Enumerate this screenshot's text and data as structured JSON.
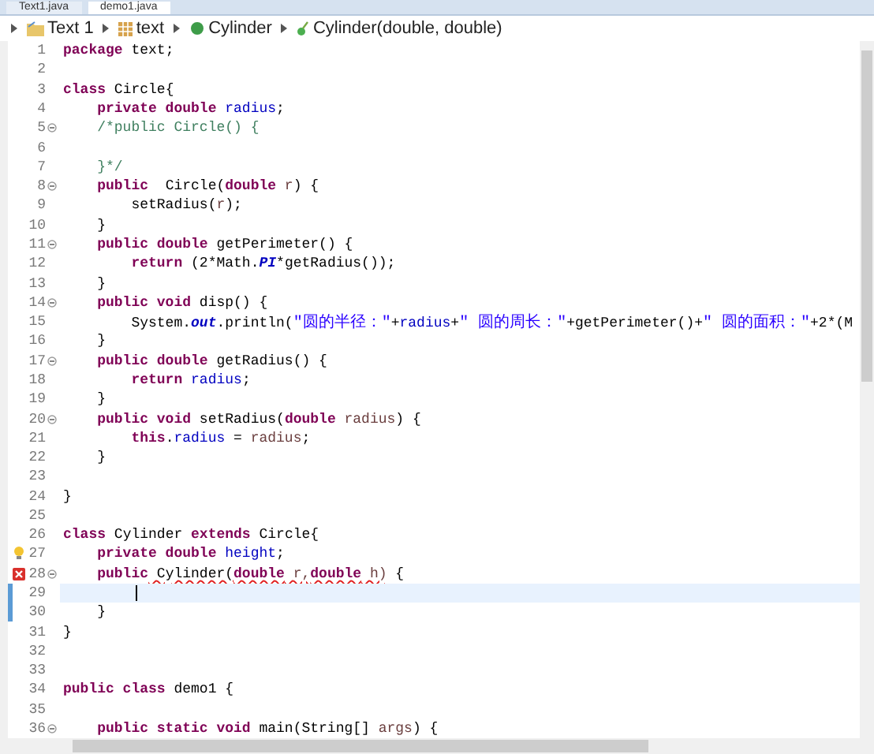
{
  "tabs": [
    {
      "label": "Text1.java",
      "selected": false
    },
    {
      "label": "demo1.java",
      "selected": true
    }
  ],
  "breadcrumb": [
    {
      "kind": "project",
      "label": "Text 1"
    },
    {
      "kind": "package",
      "label": "text"
    },
    {
      "kind": "class",
      "label": "Cylinder"
    },
    {
      "kind": "method",
      "label": "Cylinder(double, double)"
    }
  ],
  "lines": [
    {
      "number": "1",
      "tokens": [
        {
          "kind": "kw",
          "text": "package"
        },
        {
          "kind": "plain",
          "text": " text;"
        }
      ]
    },
    {
      "number": "2"
    },
    {
      "number": "3",
      "tokens": [
        {
          "kind": "kw",
          "text": "class"
        },
        {
          "kind": "plain",
          "text": " Circle{"
        }
      ]
    },
    {
      "number": "4",
      "tokens": [
        {
          "kind": "kw",
          "text": "    private double"
        },
        {
          "kind": "field",
          "text": " radius"
        },
        {
          "kind": "plain",
          "text": ";"
        }
      ]
    },
    {
      "number": "5",
      "fold": true,
      "tokens": [
        {
          "kind": "comment",
          "text": "    /*public Circle() {"
        }
      ]
    },
    {
      "number": "6"
    },
    {
      "number": "7",
      "tokens": [
        {
          "kind": "comment",
          "text": "    }*/"
        }
      ]
    },
    {
      "number": "8",
      "fold": true,
      "tokens": [
        {
          "kind": "kw",
          "text": "    public"
        },
        {
          "kind": "plain",
          "text": "  Circle("
        },
        {
          "kind": "kw",
          "text": "double"
        },
        {
          "kind": "param",
          "text": " r"
        },
        {
          "kind": "plain",
          "text": ") {"
        }
      ]
    },
    {
      "number": "9",
      "tokens": [
        {
          "kind": "plain",
          "text": "        setRadius("
        },
        {
          "kind": "param",
          "text": "r"
        },
        {
          "kind": "plain",
          "text": ");"
        }
      ]
    },
    {
      "number": "10",
      "tokens": [
        {
          "kind": "plain",
          "text": "    }"
        }
      ]
    },
    {
      "number": "11",
      "fold": true,
      "tokens": [
        {
          "kind": "kw",
          "text": "    public double"
        },
        {
          "kind": "plain",
          "text": " getPerimeter() {"
        }
      ]
    },
    {
      "number": "12",
      "tokens": [
        {
          "kind": "kw",
          "text": "        return"
        },
        {
          "kind": "plain",
          "text": " (2*Math."
        },
        {
          "kind": "static",
          "text": "PI"
        },
        {
          "kind": "plain",
          "text": "*getRadius());"
        }
      ]
    },
    {
      "number": "13",
      "tokens": [
        {
          "kind": "plain",
          "text": "    }"
        }
      ]
    },
    {
      "number": "14",
      "fold": true,
      "tokens": [
        {
          "kind": "kw",
          "text": "    public void"
        },
        {
          "kind": "plain",
          "text": " disp() {"
        }
      ]
    },
    {
      "number": "15",
      "tokens": [
        {
          "kind": "plain",
          "text": "        System."
        },
        {
          "kind": "static",
          "text": "out"
        },
        {
          "kind": "plain",
          "text": ".println("
        },
        {
          "kind": "str",
          "text": "\"圆的半径：\""
        },
        {
          "kind": "plain",
          "text": "+"
        },
        {
          "kind": "field",
          "text": "radius"
        },
        {
          "kind": "plain",
          "text": "+"
        },
        {
          "kind": "str",
          "text": "\" 圆的周长：\""
        },
        {
          "kind": "plain",
          "text": "+getPerimeter()+"
        },
        {
          "kind": "str",
          "text": "\" 圆的面积：\""
        },
        {
          "kind": "plain",
          "text": "+2*(M"
        }
      ]
    },
    {
      "number": "16",
      "tokens": [
        {
          "kind": "plain",
          "text": "    }"
        }
      ]
    },
    {
      "number": "17",
      "fold": true,
      "tokens": [
        {
          "kind": "kw",
          "text": "    public double"
        },
        {
          "kind": "plain",
          "text": " getRadius() {"
        }
      ]
    },
    {
      "number": "18",
      "tokens": [
        {
          "kind": "kw",
          "text": "        return"
        },
        {
          "kind": "field",
          "text": " radius"
        },
        {
          "kind": "plain",
          "text": ";"
        }
      ]
    },
    {
      "number": "19",
      "tokens": [
        {
          "kind": "plain",
          "text": "    }"
        }
      ]
    },
    {
      "number": "20",
      "fold": true,
      "tokens": [
        {
          "kind": "kw",
          "text": "    public void"
        },
        {
          "kind": "plain",
          "text": " setRadius("
        },
        {
          "kind": "kw",
          "text": "double"
        },
        {
          "kind": "param",
          "text": " radius"
        },
        {
          "kind": "plain",
          "text": ") {"
        }
      ]
    },
    {
      "number": "21",
      "tokens": [
        {
          "kind": "kw",
          "text": "        this"
        },
        {
          "kind": "plain",
          "text": "."
        },
        {
          "kind": "field",
          "text": "radius"
        },
        {
          "kind": "plain",
          "text": " = "
        },
        {
          "kind": "param",
          "text": "radius"
        },
        {
          "kind": "plain",
          "text": ";"
        }
      ]
    },
    {
      "number": "22",
      "tokens": [
        {
          "kind": "plain",
          "text": "    }"
        }
      ]
    },
    {
      "number": "23"
    },
    {
      "number": "24",
      "tokens": [
        {
          "kind": "plain",
          "text": "}"
        }
      ]
    },
    {
      "number": "25"
    },
    {
      "number": "26",
      "tokens": [
        {
          "kind": "kw",
          "text": "class"
        },
        {
          "kind": "plain",
          "text": " Cylinder "
        },
        {
          "kind": "kw",
          "text": "extends"
        },
        {
          "kind": "plain",
          "text": " Circle{"
        }
      ]
    },
    {
      "number": "27",
      "warning": true,
      "tokens": [
        {
          "kind": "kw",
          "text": "    private double"
        },
        {
          "kind": "field",
          "text": " height"
        },
        {
          "kind": "plain",
          "text": ";"
        }
      ]
    },
    {
      "number": "28",
      "fold": true,
      "error": true,
      "tokens": [
        {
          "kind": "kw",
          "text": "    public"
        },
        {
          "kind": "plain",
          "text": " Cylinder(",
          "error": true
        },
        {
          "kind": "kw",
          "text": "double",
          "error": true
        },
        {
          "kind": "param",
          "text": " r,",
          "error": true
        },
        {
          "kind": "kw",
          "text": "double",
          "error": true
        },
        {
          "kind": "param",
          "text": " h)",
          "error": true
        },
        {
          "kind": "plain",
          "text": " {"
        }
      ]
    },
    {
      "number": "29",
      "changed": true,
      "current": true
    },
    {
      "number": "30",
      "changed": true,
      "tokens": [
        {
          "kind": "plain",
          "text": "    }"
        }
      ]
    },
    {
      "number": "31",
      "tokens": [
        {
          "kind": "plain",
          "text": "}"
        }
      ]
    },
    {
      "number": "32"
    },
    {
      "number": "33"
    },
    {
      "number": "34",
      "tokens": [
        {
          "kind": "kw",
          "text": "public class"
        },
        {
          "kind": "plain",
          "text": " demo1 {"
        }
      ]
    },
    {
      "number": "35"
    },
    {
      "number": "36",
      "fold": true,
      "tokens": [
        {
          "kind": "kw",
          "text": "    public static void"
        },
        {
          "kind": "plain",
          "text": " main(String[] "
        },
        {
          "kind": "param",
          "text": "args"
        },
        {
          "kind": "plain",
          "text": ") {"
        }
      ]
    }
  ]
}
